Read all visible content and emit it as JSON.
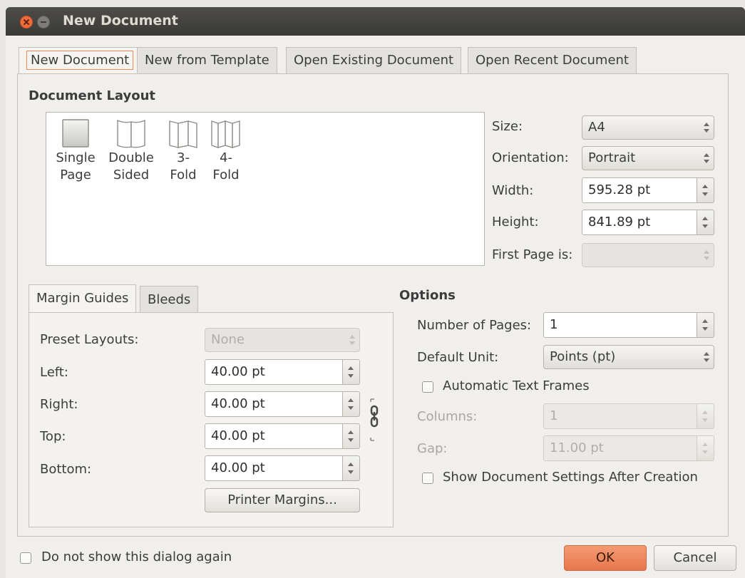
{
  "window": {
    "title": "New Document"
  },
  "tabs": [
    "New Document",
    "New from Template",
    "Open Existing Document",
    "Open Recent Document"
  ],
  "layout": {
    "heading": "Document Layout",
    "items": [
      {
        "line1": "Single",
        "line2": "Page"
      },
      {
        "line1": "Double",
        "line2": "Sided"
      },
      {
        "line1": "3-",
        "line2": "Fold"
      },
      {
        "line1": "4-",
        "line2": "Fold"
      }
    ]
  },
  "page": {
    "size_label": "Size:",
    "size_value": "A4",
    "orientation_label": "Orientation:",
    "orientation_value": "Portrait",
    "width_label": "Width:",
    "width_value": "595.28 pt",
    "height_label": "Height:",
    "height_value": "841.89 pt",
    "first_page_label": "First Page is:",
    "first_page_value": ""
  },
  "margins": {
    "tabs": [
      "Margin Guides",
      "Bleeds"
    ],
    "preset_label": "Preset Layouts:",
    "preset_value": "None",
    "left_label": "Left:",
    "left_value": "40.00 pt",
    "right_label": "Right:",
    "right_value": "40.00 pt",
    "top_label": "Top:",
    "top_value": "40.00 pt",
    "bottom_label": "Bottom:",
    "bottom_value": "40.00 pt",
    "printer_button": "Printer Margins..."
  },
  "options": {
    "heading": "Options",
    "pages_label": "Number of Pages:",
    "pages_value": "1",
    "unit_label": "Default Unit:",
    "unit_value": "Points (pt)",
    "auto_frames_label": "Automatic Text Frames",
    "auto_frames_checked": false,
    "columns_label": "Columns:",
    "columns_value": "1",
    "gap_label": "Gap:",
    "gap_value": "11.00 pt",
    "show_settings_label": "Show Document Settings After Creation",
    "show_settings_checked": false
  },
  "footer": {
    "dont_show_label": "Do not show this dialog again",
    "dont_show_checked": false,
    "ok": "OK",
    "cancel": "Cancel"
  },
  "colors": {
    "accent": "#ea7a4d",
    "titlebar": "#3c3b37",
    "background": "#f0efec"
  }
}
